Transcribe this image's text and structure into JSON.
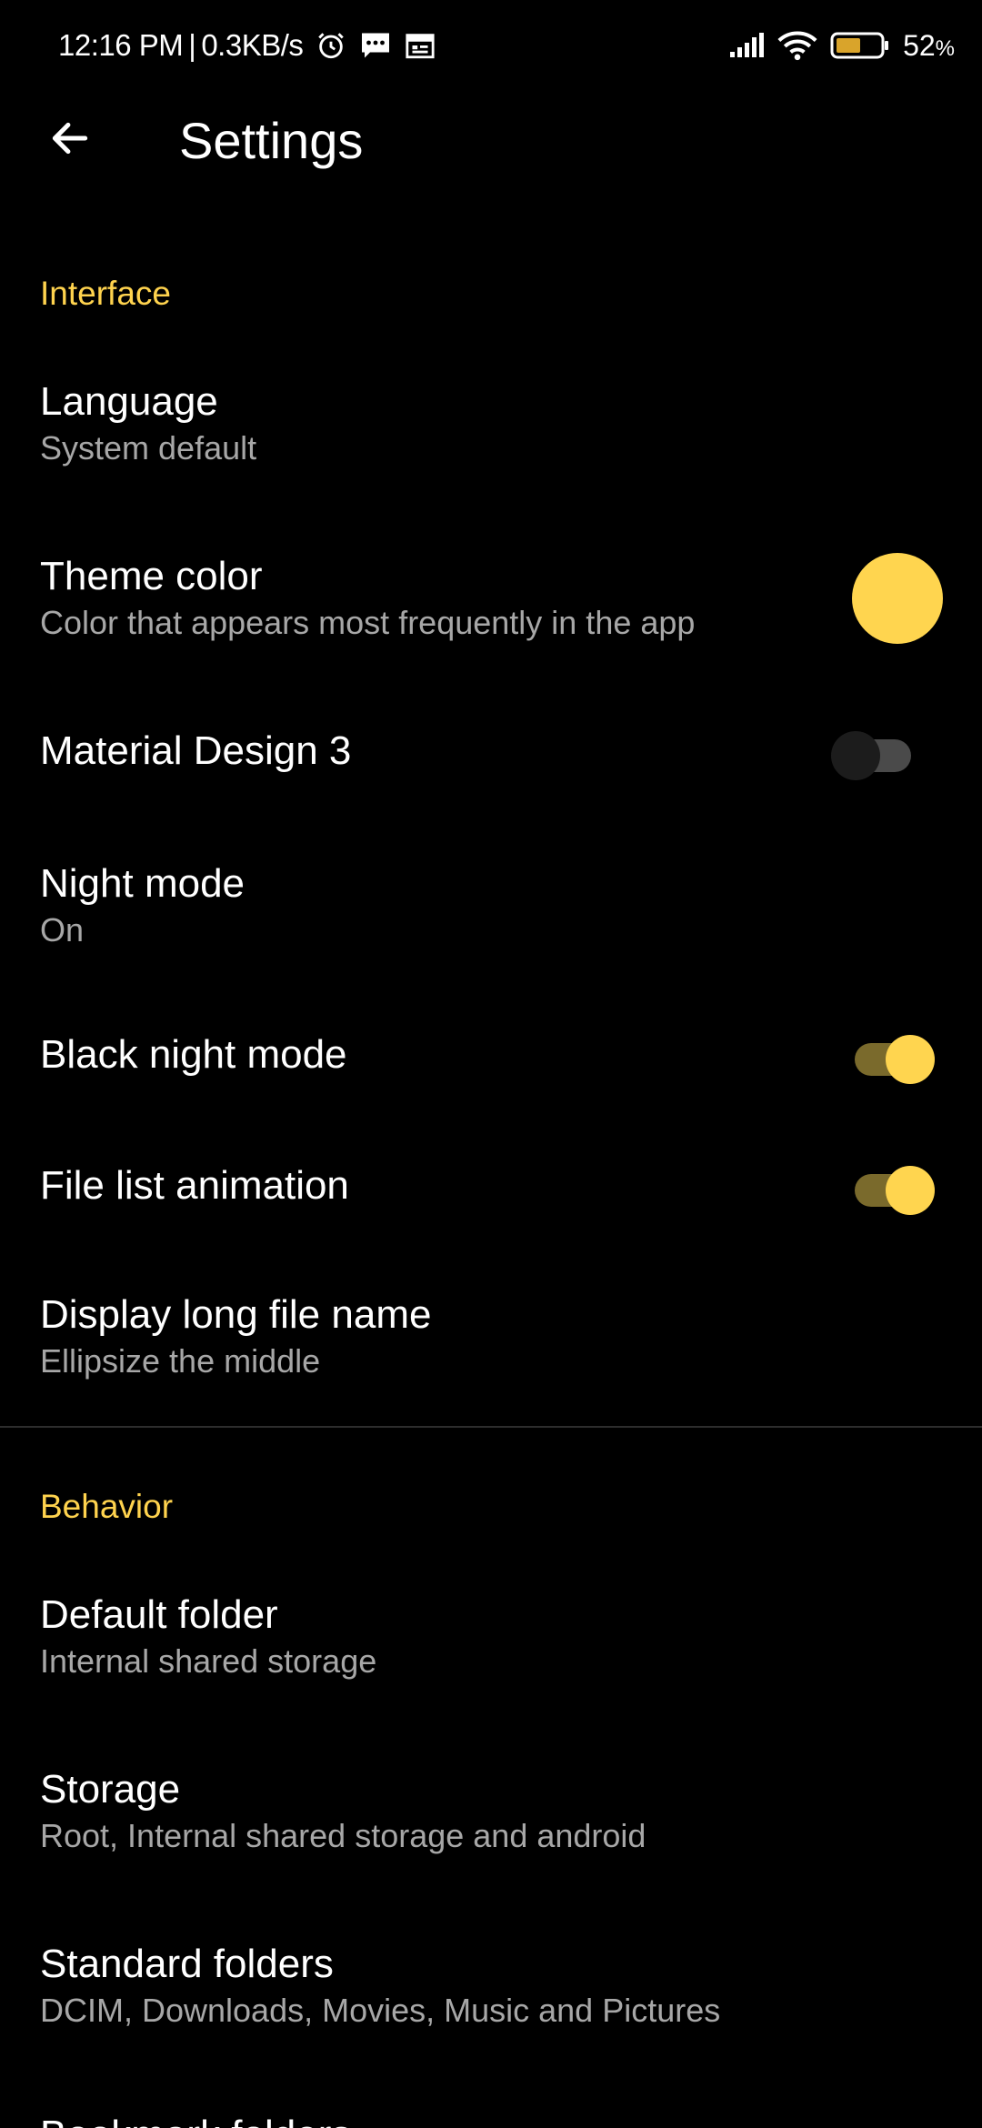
{
  "status_bar": {
    "time": "12:16 PM",
    "separator": "|",
    "speed": "0.3KB/s",
    "battery": "52",
    "battery_unit": "%",
    "icons": [
      "alarm-icon",
      "message-icon",
      "calendar-icon",
      "signal-icon",
      "wifi-icon",
      "battery-icon"
    ]
  },
  "app_bar": {
    "title": "Settings",
    "back_icon": "back-arrow-icon"
  },
  "sections": {
    "interface": "Interface",
    "behavior": "Behavior"
  },
  "items": {
    "language": {
      "title": "Language",
      "summary": "System default"
    },
    "theme_color": {
      "title": "Theme color",
      "summary": "Color that appears most frequently in the app",
      "color": "#ffd54f"
    },
    "material_design": {
      "title": "Material Design 3",
      "enabled": false
    },
    "night_mode": {
      "title": "Night mode",
      "summary": "On"
    },
    "black_night_mode": {
      "title": "Black night mode",
      "enabled": true
    },
    "file_list_animation": {
      "title": "File list animation",
      "enabled": true
    },
    "long_file_name": {
      "title": "Display long file name",
      "summary": "Ellipsize the middle"
    },
    "default_folder": {
      "title": "Default folder",
      "summary": "Internal shared storage"
    },
    "storage": {
      "title": "Storage",
      "summary": "Root, Internal shared storage and android"
    },
    "standard_folders": {
      "title": "Standard folders",
      "summary": "DCIM, Downloads, Movies, Music and Pictures"
    },
    "partial_next": {
      "title": "Bookmark folders"
    }
  },
  "colors": {
    "accent": "#ffd54f",
    "section_header": "#ffd34e",
    "summary_text": "#a7a7a7",
    "switch_on_track": "#7a6a2c",
    "switch_off_track": "#4a4a4a",
    "switch_off_thumb": "#1c1c1c"
  }
}
